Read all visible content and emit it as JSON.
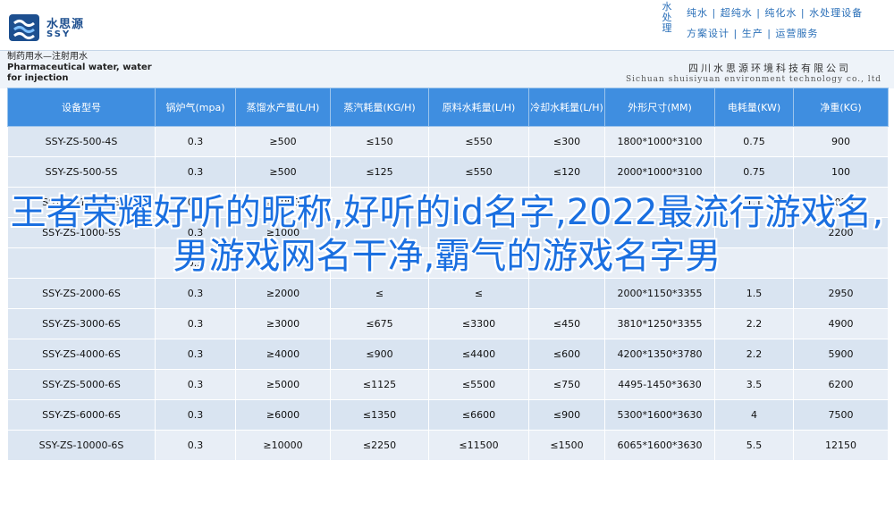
{
  "brand": {
    "logo_cn": "水思源",
    "logo_en": "SSY",
    "vertical_name": "水处理",
    "slogan_line1": "纯水 | 超纯水 | 纯化水 | 水处理设备",
    "slogan_line2": "方案设计 | 生产 | 运营服务"
  },
  "header": {
    "product_title_cn": "制药用水—注射用水",
    "product_title_en": "Pharmaceutical water, water for injection",
    "company_cn": "四川水思源环境科技有限公司",
    "company_en": "Sichuan shuisiyuan environment technology co., ltd"
  },
  "table": {
    "columns": [
      "设备型号",
      "锅炉气(mpa)",
      "蒸馏水产量(L/H)",
      "蒸汽耗量(KG/H)",
      "原料水耗量(L/H)",
      "冷却水耗量(L/H)",
      "外形尺寸(MM)",
      "电耗量(KW)",
      "净重(KG)"
    ],
    "rows": [
      [
        "SSY-ZS-500-4S",
        "0.3",
        "≥500",
        "≤150",
        "≤550",
        "≤300",
        "1800*1000*3100",
        "0.75",
        "900"
      ],
      [
        "SSY-ZS-500-5S",
        "0.3",
        "≥500",
        "≤125",
        "≤550",
        "≤120",
        "2000*1000*3100",
        "0.75",
        "100"
      ],
      [
        "SSY-ZS-1000-4S",
        "0.3",
        "≥1000",
        "",
        "",
        "",
        "",
        "1.1",
        "2050"
      ],
      [
        "SSY-ZS-1000-5S",
        "0.3",
        "≥1000",
        "",
        "",
        "",
        "",
        "",
        "2200"
      ],
      [
        "",
        "0.3",
        "",
        "",
        "",
        "",
        "",
        "",
        ""
      ],
      [
        "SSY-ZS-2000-6S",
        "0.3",
        "≥2000",
        "≤",
        "≤",
        "",
        "2000*1150*3355",
        "1.5",
        "2950"
      ],
      [
        "SSY-ZS-3000-6S",
        "0.3",
        "≥3000",
        "≤675",
        "≤3300",
        "≤450",
        "3810*1250*3355",
        "2.2",
        "4900"
      ],
      [
        "SSY-ZS-4000-6S",
        "0.3",
        "≥4000",
        "≤900",
        "≤4400",
        "≤600",
        "4200*1350*3780",
        "2.2",
        "5900"
      ],
      [
        "SSY-ZS-5000-6S",
        "0.3",
        "≥5000",
        "≤1125",
        "≤5500",
        "≤750",
        "4495-1450*3630",
        "3.5",
        "6200"
      ],
      [
        "SSY-ZS-6000-6S",
        "0.3",
        "≥6000",
        "≤1350",
        "≤6600",
        "≤900",
        "5300*1600*3630",
        "4",
        "7500"
      ],
      [
        "SSY-ZS-10000-6S",
        "0.3",
        "≥10000",
        "≤2250",
        "≤11500",
        "≤1500",
        "6065*1600*3630",
        "5.5",
        "12150"
      ]
    ]
  },
  "overlay": {
    "text": "王者荣耀好听的昵称,好听的id名字,2022最流行游戏名,男游戏网名干净,霸气的游戏名字男"
  },
  "colors": {
    "header_blue": "#3f8ee0",
    "overlay_blue": "#1a6fe0",
    "brand_blue": "#1d4f8f"
  }
}
